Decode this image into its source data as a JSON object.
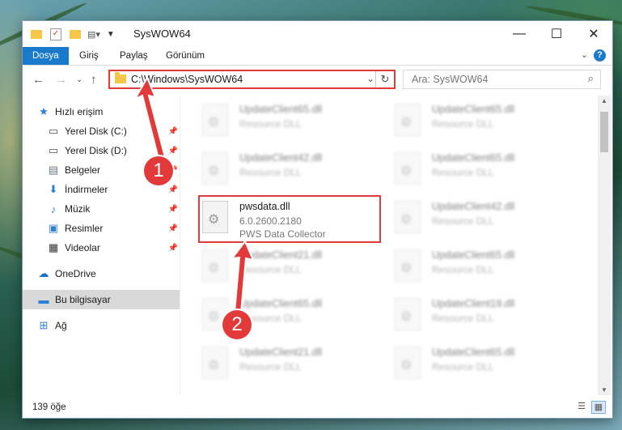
{
  "window": {
    "title": "SysWOW64"
  },
  "ribbon": {
    "tabs": [
      "Dosya",
      "Giriş",
      "Paylaş",
      "Görünüm"
    ],
    "active_tab": "Dosya"
  },
  "address": {
    "path": "C:\\Windows\\SysWOW64"
  },
  "search": {
    "placeholder": "Ara: SysWOW64"
  },
  "nav": {
    "items": [
      {
        "label": "Hızlı erişim",
        "icon": "star-icon"
      },
      {
        "label": "Yerel Disk (C:)",
        "icon": "drive-icon",
        "pinned": true
      },
      {
        "label": "Yerel Disk (D:)",
        "icon": "drive-icon",
        "pinned": true
      },
      {
        "label": "Belgeler",
        "icon": "documents-icon",
        "pinned": true
      },
      {
        "label": "İndirmeler",
        "icon": "download-icon",
        "pinned": true
      },
      {
        "label": "Müzik",
        "icon": "music-icon",
        "pinned": true
      },
      {
        "label": "Resimler",
        "icon": "pictures-icon",
        "pinned": true
      },
      {
        "label": "Videolar",
        "icon": "videos-icon",
        "pinned": true
      },
      {
        "label": "OneDrive",
        "icon": "cloud-icon"
      },
      {
        "label": "Bu bilgisayar",
        "icon": "computer-icon",
        "selected": true
      },
      {
        "label": "Ağ",
        "icon": "network-icon"
      }
    ]
  },
  "files": [
    {
      "name": "UpdateClient65.dll",
      "line2": "Resource DLL"
    },
    {
      "name": "UpdateClient65.dll",
      "line2": "Resource DLL"
    },
    {
      "name": "UpdateClient42.dll",
      "line2": "Resource DLL"
    },
    {
      "name": "UpdateClient65.dll",
      "line2": "Resource DLL"
    },
    {
      "name": "pwsdata.dll",
      "line2": "6.0.2600.2180",
      "line3": "PWS Data Collector",
      "selected": true
    },
    {
      "name": "UpdateClient42.dll",
      "line2": "Resource DLL"
    },
    {
      "name": "UpdateClient21.dll",
      "line2": "Resource DLL"
    },
    {
      "name": "UpdateClient65.dll",
      "line2": "Resource DLL"
    },
    {
      "name": "UpdateClient65.dll",
      "line2": "Resource DLL"
    },
    {
      "name": "UpdateClient19.dll",
      "line2": "Resource DLL"
    },
    {
      "name": "UpdateClient21.dll",
      "line2": "Resource DLL"
    },
    {
      "name": "UpdateClient65.dll",
      "line2": "Resource DLL"
    }
  ],
  "status": {
    "count": "139 öğe"
  },
  "callouts": [
    "1",
    "2"
  ],
  "colors": {
    "accent": "#1979ca",
    "highlight": "#e03a3a"
  }
}
